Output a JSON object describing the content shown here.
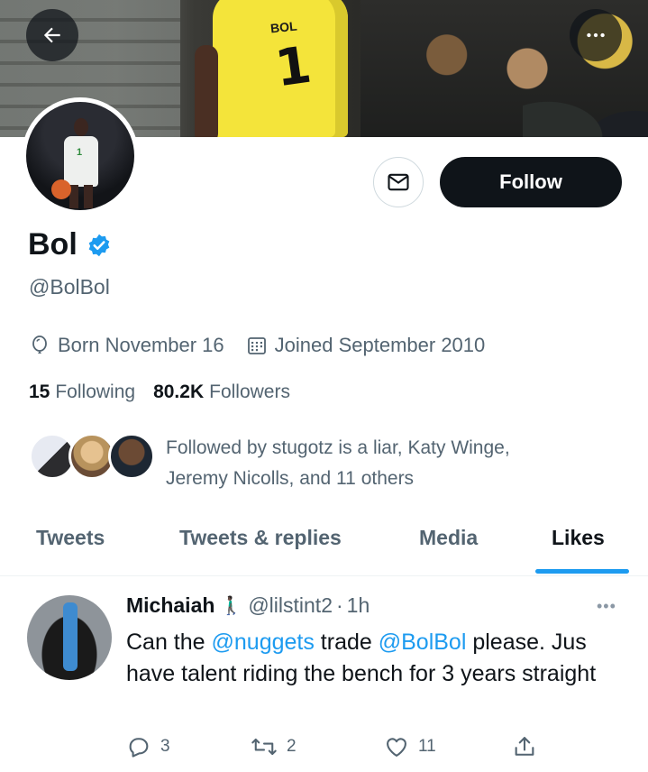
{
  "banner": {
    "jersey_text": "BOL",
    "jersey_number": "1"
  },
  "profile": {
    "display_name": "Bol",
    "handle": "@BolBol",
    "birthday": "Born November 16",
    "joined": "Joined September 2010",
    "following_count": "15",
    "following_label": "Following",
    "followers_count": "80.2K",
    "followers_label": "Followers",
    "followed_by_text": "Followed by stugotz is a liar, Katy Winge, Jeremy Nicolls, and 11 others",
    "avatar_number": "1"
  },
  "actions": {
    "follow_label": "Follow"
  },
  "tabs": [
    {
      "label": "Tweets",
      "active": false
    },
    {
      "label": "Tweets & replies",
      "active": false
    },
    {
      "label": "Media",
      "active": false
    },
    {
      "label": "Likes",
      "active": true
    }
  ],
  "tweet": {
    "author_name": "Michaiah",
    "author_emoji": "🚶🏿‍♂️",
    "author_handle": "@lilstint2",
    "separator": "·",
    "time": "1h",
    "more_label": "•••",
    "text_part1": "Can the ",
    "mention1": "@nuggets",
    "text_part2": " trade ",
    "mention2": "@BolBol",
    "text_part3": " please. Jus have talent riding the bench for 3 years straight",
    "reply_count": "3",
    "retweet_count": "2",
    "like_count": "11"
  },
  "colors": {
    "accent": "#1d9bf0",
    "text": "#0f1419",
    "secondary": "#536471",
    "follow_bg": "#0f1419"
  },
  "icons": {
    "back": "back-arrow-icon",
    "more": "more-icon",
    "message": "envelope-icon",
    "verified": "verified-badge-icon",
    "birthday": "balloon-icon",
    "joined": "calendar-icon",
    "reply": "reply-icon",
    "retweet": "retweet-icon",
    "like": "heart-icon",
    "share": "share-icon"
  }
}
